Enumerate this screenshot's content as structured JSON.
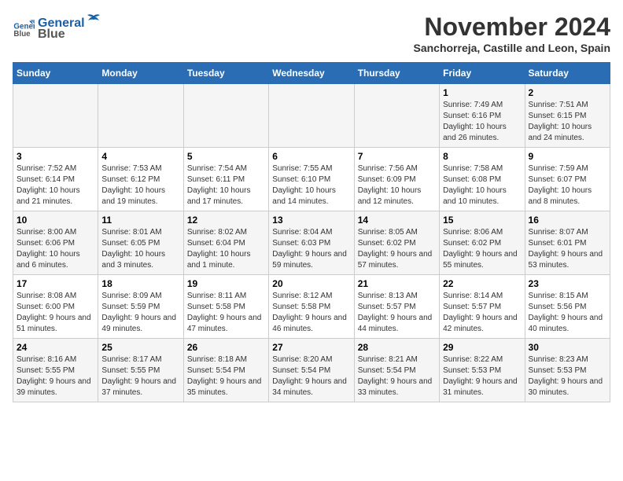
{
  "logo": {
    "line1": "General",
    "line2": "Blue"
  },
  "title": "November 2024",
  "subtitle": "Sanchorreja, Castille and Leon, Spain",
  "days_of_week": [
    "Sunday",
    "Monday",
    "Tuesday",
    "Wednesday",
    "Thursday",
    "Friday",
    "Saturday"
  ],
  "weeks": [
    [
      {
        "day": "",
        "info": ""
      },
      {
        "day": "",
        "info": ""
      },
      {
        "day": "",
        "info": ""
      },
      {
        "day": "",
        "info": ""
      },
      {
        "day": "",
        "info": ""
      },
      {
        "day": "1",
        "info": "Sunrise: 7:49 AM\nSunset: 6:16 PM\nDaylight: 10 hours and 26 minutes."
      },
      {
        "day": "2",
        "info": "Sunrise: 7:51 AM\nSunset: 6:15 PM\nDaylight: 10 hours and 24 minutes."
      }
    ],
    [
      {
        "day": "3",
        "info": "Sunrise: 7:52 AM\nSunset: 6:14 PM\nDaylight: 10 hours and 21 minutes."
      },
      {
        "day": "4",
        "info": "Sunrise: 7:53 AM\nSunset: 6:12 PM\nDaylight: 10 hours and 19 minutes."
      },
      {
        "day": "5",
        "info": "Sunrise: 7:54 AM\nSunset: 6:11 PM\nDaylight: 10 hours and 17 minutes."
      },
      {
        "day": "6",
        "info": "Sunrise: 7:55 AM\nSunset: 6:10 PM\nDaylight: 10 hours and 14 minutes."
      },
      {
        "day": "7",
        "info": "Sunrise: 7:56 AM\nSunset: 6:09 PM\nDaylight: 10 hours and 12 minutes."
      },
      {
        "day": "8",
        "info": "Sunrise: 7:58 AM\nSunset: 6:08 PM\nDaylight: 10 hours and 10 minutes."
      },
      {
        "day": "9",
        "info": "Sunrise: 7:59 AM\nSunset: 6:07 PM\nDaylight: 10 hours and 8 minutes."
      }
    ],
    [
      {
        "day": "10",
        "info": "Sunrise: 8:00 AM\nSunset: 6:06 PM\nDaylight: 10 hours and 6 minutes."
      },
      {
        "day": "11",
        "info": "Sunrise: 8:01 AM\nSunset: 6:05 PM\nDaylight: 10 hours and 3 minutes."
      },
      {
        "day": "12",
        "info": "Sunrise: 8:02 AM\nSunset: 6:04 PM\nDaylight: 10 hours and 1 minute."
      },
      {
        "day": "13",
        "info": "Sunrise: 8:04 AM\nSunset: 6:03 PM\nDaylight: 9 hours and 59 minutes."
      },
      {
        "day": "14",
        "info": "Sunrise: 8:05 AM\nSunset: 6:02 PM\nDaylight: 9 hours and 57 minutes."
      },
      {
        "day": "15",
        "info": "Sunrise: 8:06 AM\nSunset: 6:02 PM\nDaylight: 9 hours and 55 minutes."
      },
      {
        "day": "16",
        "info": "Sunrise: 8:07 AM\nSunset: 6:01 PM\nDaylight: 9 hours and 53 minutes."
      }
    ],
    [
      {
        "day": "17",
        "info": "Sunrise: 8:08 AM\nSunset: 6:00 PM\nDaylight: 9 hours and 51 minutes."
      },
      {
        "day": "18",
        "info": "Sunrise: 8:09 AM\nSunset: 5:59 PM\nDaylight: 9 hours and 49 minutes."
      },
      {
        "day": "19",
        "info": "Sunrise: 8:11 AM\nSunset: 5:58 PM\nDaylight: 9 hours and 47 minutes."
      },
      {
        "day": "20",
        "info": "Sunrise: 8:12 AM\nSunset: 5:58 PM\nDaylight: 9 hours and 46 minutes."
      },
      {
        "day": "21",
        "info": "Sunrise: 8:13 AM\nSunset: 5:57 PM\nDaylight: 9 hours and 44 minutes."
      },
      {
        "day": "22",
        "info": "Sunrise: 8:14 AM\nSunset: 5:57 PM\nDaylight: 9 hours and 42 minutes."
      },
      {
        "day": "23",
        "info": "Sunrise: 8:15 AM\nSunset: 5:56 PM\nDaylight: 9 hours and 40 minutes."
      }
    ],
    [
      {
        "day": "24",
        "info": "Sunrise: 8:16 AM\nSunset: 5:55 PM\nDaylight: 9 hours and 39 minutes."
      },
      {
        "day": "25",
        "info": "Sunrise: 8:17 AM\nSunset: 5:55 PM\nDaylight: 9 hours and 37 minutes."
      },
      {
        "day": "26",
        "info": "Sunrise: 8:18 AM\nSunset: 5:54 PM\nDaylight: 9 hours and 35 minutes."
      },
      {
        "day": "27",
        "info": "Sunrise: 8:20 AM\nSunset: 5:54 PM\nDaylight: 9 hours and 34 minutes."
      },
      {
        "day": "28",
        "info": "Sunrise: 8:21 AM\nSunset: 5:54 PM\nDaylight: 9 hours and 33 minutes."
      },
      {
        "day": "29",
        "info": "Sunrise: 8:22 AM\nSunset: 5:53 PM\nDaylight: 9 hours and 31 minutes."
      },
      {
        "day": "30",
        "info": "Sunrise: 8:23 AM\nSunset: 5:53 PM\nDaylight: 9 hours and 30 minutes."
      }
    ]
  ]
}
